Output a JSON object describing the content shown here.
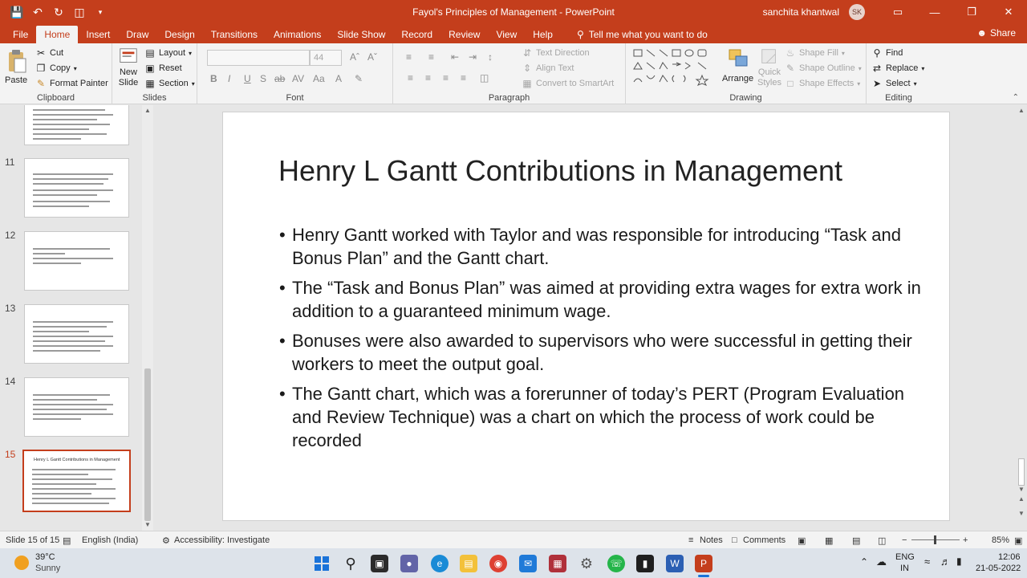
{
  "titlebar": {
    "title": "Fayol's Principles of Management  -  PowerPoint",
    "user_name": "sanchita khantwal",
    "user_initials": "SK",
    "qat_icons": [
      "save-icon",
      "undo-icon",
      "redo-icon",
      "present-icon"
    ],
    "window_buttons": [
      "ribbon-display-icon",
      "minimize-icon",
      "restore-icon",
      "close-icon"
    ]
  },
  "tabs": {
    "items": [
      "File",
      "Home",
      "Insert",
      "Draw",
      "Design",
      "Transitions",
      "Animations",
      "Slide Show",
      "Record",
      "Review",
      "View",
      "Help"
    ],
    "active": "Home",
    "tell_me": "Tell me what you want to do",
    "share": "Share"
  },
  "ribbon": {
    "clipboard": {
      "label": "Clipboard",
      "paste": "Paste",
      "cut": "Cut",
      "copy": "Copy",
      "format_painter": "Format Painter"
    },
    "slides": {
      "label": "Slides",
      "new_slide_1": "New",
      "new_slide_2": "Slide",
      "layout": "Layout",
      "reset": "Reset",
      "section": "Section"
    },
    "font": {
      "label": "Font",
      "size": "44"
    },
    "paragraph": {
      "label": "Paragraph",
      "text_direction": "Text Direction",
      "align_text": "Align Text",
      "smartart": "Convert to SmartArt"
    },
    "drawing": {
      "label": "Drawing",
      "arrange": "Arrange",
      "quick_styles_1": "Quick",
      "quick_styles_2": "Styles",
      "shape_fill": "Shape Fill",
      "shape_outline": "Shape Outline",
      "shape_effects": "Shape Effects"
    },
    "editing": {
      "label": "Editing",
      "find": "Find",
      "replace": "Replace",
      "select": "Select"
    }
  },
  "thumbnails": [
    {
      "number": "",
      "title": ""
    },
    {
      "number": "11",
      "title": ""
    },
    {
      "number": "12",
      "title": ""
    },
    {
      "number": "13",
      "title": ""
    },
    {
      "number": "14",
      "title": ""
    },
    {
      "number": "15",
      "title": "Henry L Gantt Contributions in Management",
      "selected": true
    }
  ],
  "slide": {
    "title": "Henry L Gantt Contributions in Management",
    "bullets": [
      "Henry Gantt worked with Taylor and was responsible for introducing “Task and Bonus Plan” and the Gantt chart.",
      "The “Task and Bonus Plan” was aimed at providing extra wages for extra work in addition to a guaranteed minimum wage.",
      "Bonuses were also awarded to supervisors who were successful in getting their workers to meet the output goal.",
      "The Gantt chart, which was a forerunner of today’s PERT (Program Evaluation and Review Technique) was a chart on which the process of work could be recorded"
    ]
  },
  "status": {
    "slide_count": "Slide 15 of 15",
    "language": "English (India)",
    "accessibility": "Accessibility: Investigate",
    "notes": "Notes",
    "comments": "Comments",
    "zoom": "85%"
  },
  "taskbar": {
    "temperature": "39°C",
    "weather": "Sunny",
    "lang_1": "ENG",
    "lang_2": "IN",
    "time": "12:06",
    "date": "21-05-2022"
  },
  "colors": {
    "accent": "#c43e1c",
    "ribbon_bg": "#f3f3f3"
  }
}
